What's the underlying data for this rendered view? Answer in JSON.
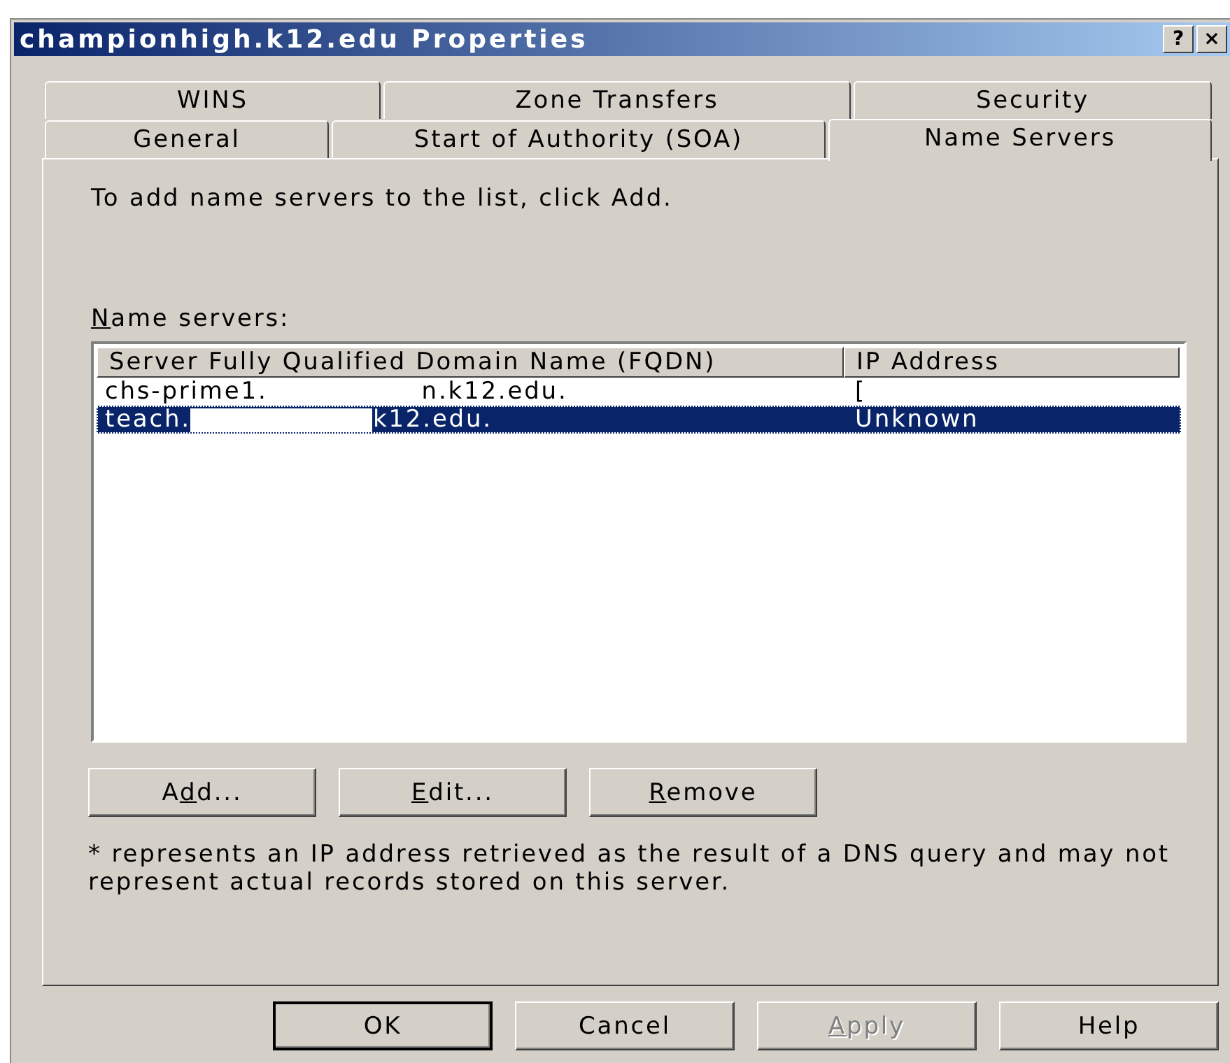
{
  "window": {
    "title": "championhigh.k12.edu Properties",
    "title_buttons": [
      "?",
      "×"
    ]
  },
  "tab_rows": [
    [
      {
        "label": "WINS",
        "selected": false
      },
      {
        "label": "Zone Transfers",
        "selected": false
      },
      {
        "label": "Security",
        "selected": false
      }
    ],
    [
      {
        "label": "General",
        "selected": false
      },
      {
        "label": "Start of Authority (SOA)",
        "selected": false
      },
      {
        "label": "Name Servers",
        "selected": true
      }
    ]
  ],
  "instruction": "To add name servers to the list, click Add.",
  "list_label": {
    "key": "N",
    "after": "ame servers:"
  },
  "table": {
    "columns": [
      "Server Fully Qualified Domain Name (FQDN)",
      "IP Address"
    ],
    "rows": [
      {
        "fqdn_start": "chs-prime1.",
        "fqdn_end": "n.k12.edu.",
        "ip": "[",
        "selected": false
      },
      {
        "fqdn_start": "teach.",
        "fqdn_end": "k12.edu.",
        "ip": "Unknown",
        "selected": true
      }
    ]
  },
  "list_buttons": [
    {
      "before": "A",
      "key": "d",
      "after": "d..."
    },
    {
      "key": "E",
      "after": "dit..."
    },
    {
      "key": "R",
      "after": "emove"
    }
  ],
  "note": "* represents an IP address retrieved as the result of a DNS query and may not represent actual records stored on this server.",
  "dialog_buttons": [
    {
      "label": "OK",
      "default": true,
      "disabled": false
    },
    {
      "label": "Cancel",
      "default": false,
      "disabled": false
    },
    {
      "key": "A",
      "after": "pply",
      "default": false,
      "disabled": true
    },
    {
      "label": "Help",
      "default": false,
      "disabled": false
    }
  ]
}
